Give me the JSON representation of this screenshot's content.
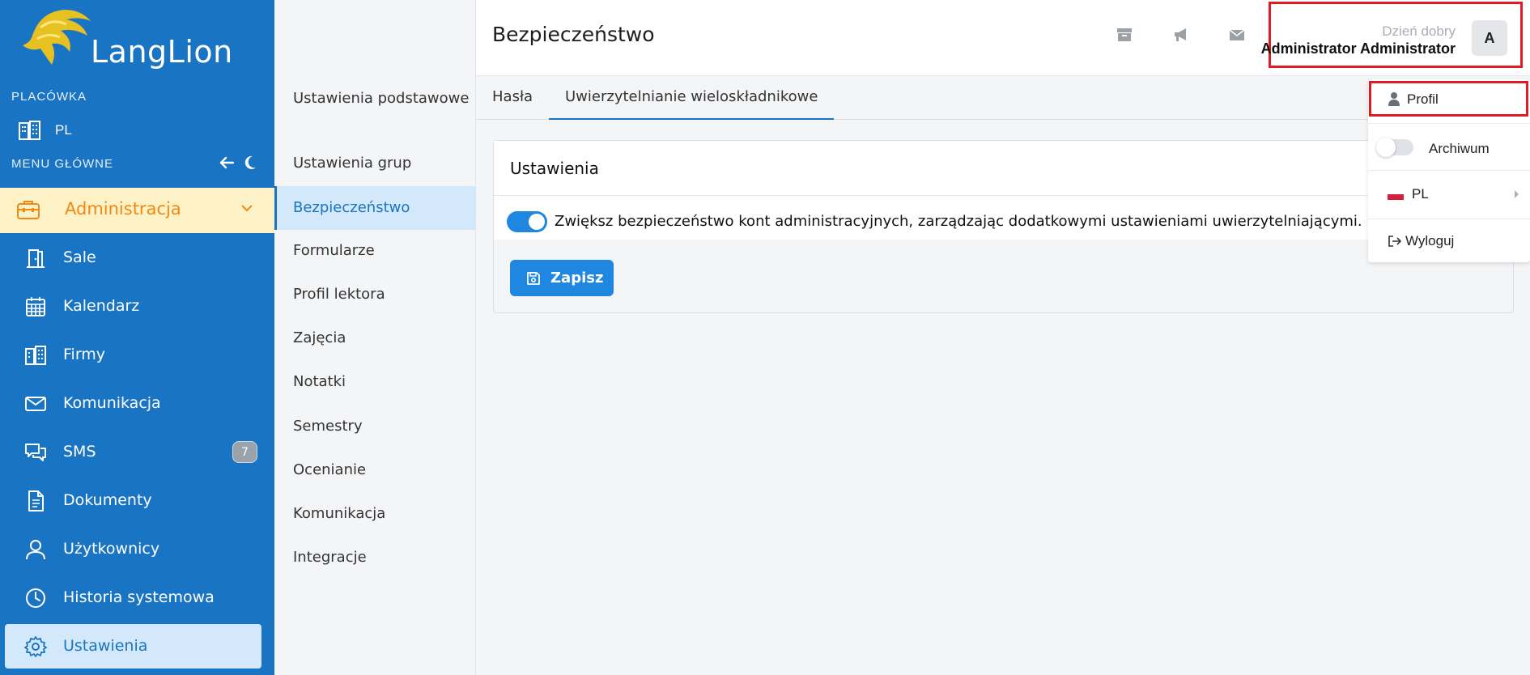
{
  "brand": {
    "logo_text": "LangLion"
  },
  "sidebar": {
    "branch_label": "PLACÓWKA",
    "branch_name": "PL",
    "main_menu_label": "MENU GŁÓWNE",
    "admin_label": "Administracja",
    "items": [
      {
        "label": "Sale",
        "icon": "door-icon"
      },
      {
        "label": "Kalendarz",
        "icon": "calendar-icon"
      },
      {
        "label": "Firmy",
        "icon": "building-icon"
      },
      {
        "label": "Komunikacja",
        "icon": "mail-icon"
      },
      {
        "label": "SMS",
        "icon": "chat-icon",
        "badge": "7"
      },
      {
        "label": "Dokumenty",
        "icon": "document-icon"
      },
      {
        "label": "Użytkownicy",
        "icon": "user-icon"
      },
      {
        "label": "Historia systemowa",
        "icon": "clock-icon"
      },
      {
        "label": "Ustawienia",
        "icon": "gear-icon",
        "active": true
      }
    ]
  },
  "submenu": {
    "items": [
      {
        "label": "Ustawienia podstawowe"
      },
      {
        "label": "Ustawienia grup"
      },
      {
        "label": "Bezpieczeństwo",
        "active": true
      },
      {
        "label": "Formularze"
      },
      {
        "label": "Profil lektora"
      },
      {
        "label": "Zajęcia"
      },
      {
        "label": "Notatki"
      },
      {
        "label": "Semestry"
      },
      {
        "label": "Ocenianie"
      },
      {
        "label": "Komunikacja"
      },
      {
        "label": "Integracje"
      }
    ]
  },
  "header": {
    "title": "Bezpieczeństwo",
    "greeting": "Dzień dobry",
    "user_name": "Administrator Administrator",
    "avatar_letter": "A"
  },
  "tabs": [
    {
      "label": "Hasła"
    },
    {
      "label": "Uwierzytelnianie wieloskładnikowe",
      "active": true
    }
  ],
  "card": {
    "title": "Ustawienia",
    "toggle_label": "Zwiększ bezpieczeństwo kont administracyjnych, zarządzając dodatkowymi ustawieniami uwierzytelniającymi.",
    "toggle_on": true,
    "save_label": "Zapisz"
  },
  "dropdown": {
    "profile_label": "Profil",
    "archive_label": "Archiwum",
    "archive_on": false,
    "language_label": "PL",
    "logout_label": "Wyloguj"
  },
  "colors": {
    "sidebar_bg": "#1a74c4",
    "accent": "#1f87e0",
    "admin_highlight": "#fdf1c6",
    "admin_text": "#f08a16",
    "highlight_border": "#e11b22"
  }
}
